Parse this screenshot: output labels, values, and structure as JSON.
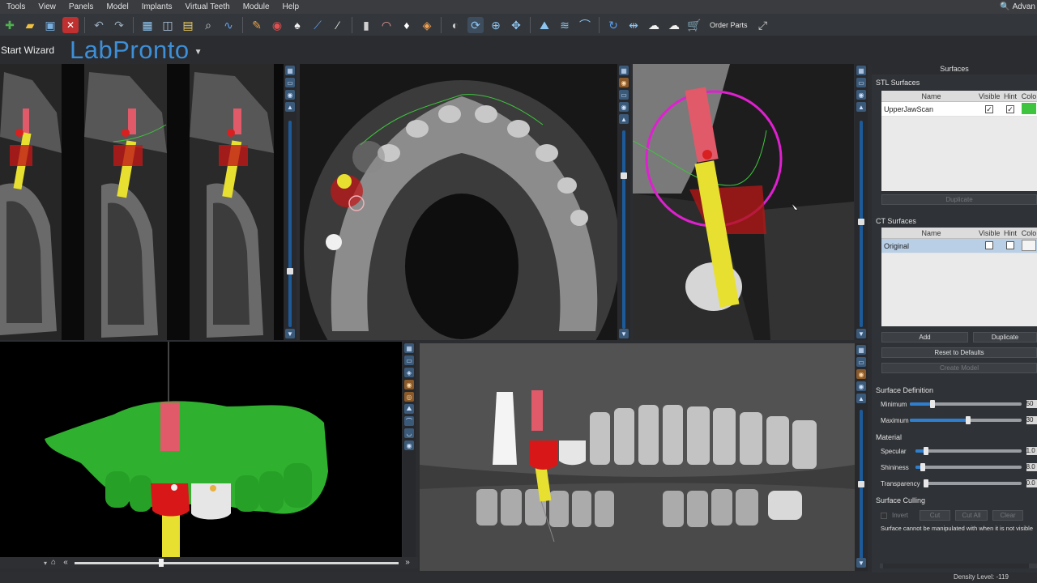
{
  "menu": {
    "items": [
      "Tools",
      "View",
      "Panels",
      "Model",
      "Implants",
      "Virtual Teeth",
      "Module",
      "Help"
    ],
    "advanced_label": "Advan"
  },
  "toolbar": {
    "order_parts_label": "Order Parts"
  },
  "brand": {
    "start_wizard": "Start Wizard",
    "logo": "LabPronto"
  },
  "panel": {
    "title": "Surfaces",
    "stl": {
      "title": "STL Surfaces",
      "columns": [
        "Name",
        "Visible",
        "Hint",
        "Colo"
      ],
      "rows": [
        {
          "name": "UpperJawScan",
          "visible": true,
          "hint": true,
          "color": "#3ec43e"
        }
      ],
      "duplicate_label": "Duplicate"
    },
    "ct": {
      "title": "CT Surfaces",
      "columns": [
        "Name",
        "Visible",
        "Hint",
        "Colo"
      ],
      "rows": [
        {
          "name": "Original",
          "visible": false,
          "hint": false
        }
      ],
      "add_label": "Add",
      "duplicate_label": "Duplicate",
      "reset_label": "Reset to Defaults",
      "create_model_label": "Create Model"
    },
    "surface_definition": {
      "title": "Surface Definition",
      "minimum_label": "Minimum",
      "minimum_value": 0.2,
      "minimum_spin": "50",
      "maximum_label": "Maximum",
      "maximum_value": 0.52,
      "maximum_spin": "30"
    },
    "material": {
      "title": "Material",
      "specular_label": "Specular",
      "specular_value": 0.1,
      "specular_spin": "1.0",
      "shininess_label": "Shininess",
      "shininess_value": 0.07,
      "shininess_spin": "8.0",
      "transparency_label": "Transparency",
      "transparency_value": 0.0,
      "transparency_spin": "0.0"
    },
    "culling": {
      "title": "Surface Culling",
      "invert_label": "Invert",
      "cut_label": "Cut",
      "cut_all_label": "Cut All",
      "clear_label": "Clear",
      "note": "Surface cannot be manipulated with when it is not visible"
    }
  },
  "status": {
    "density": "Density Level: -119"
  },
  "colors": {
    "accent": "#2f7fd0",
    "logo": "#3d8fd8",
    "scan_green": "#3ec43e",
    "implant_yellow": "#e8e030",
    "abutment_pink": "#e05a6a",
    "crown_red": "#d81818",
    "guide_magenta": "#e020d0"
  }
}
